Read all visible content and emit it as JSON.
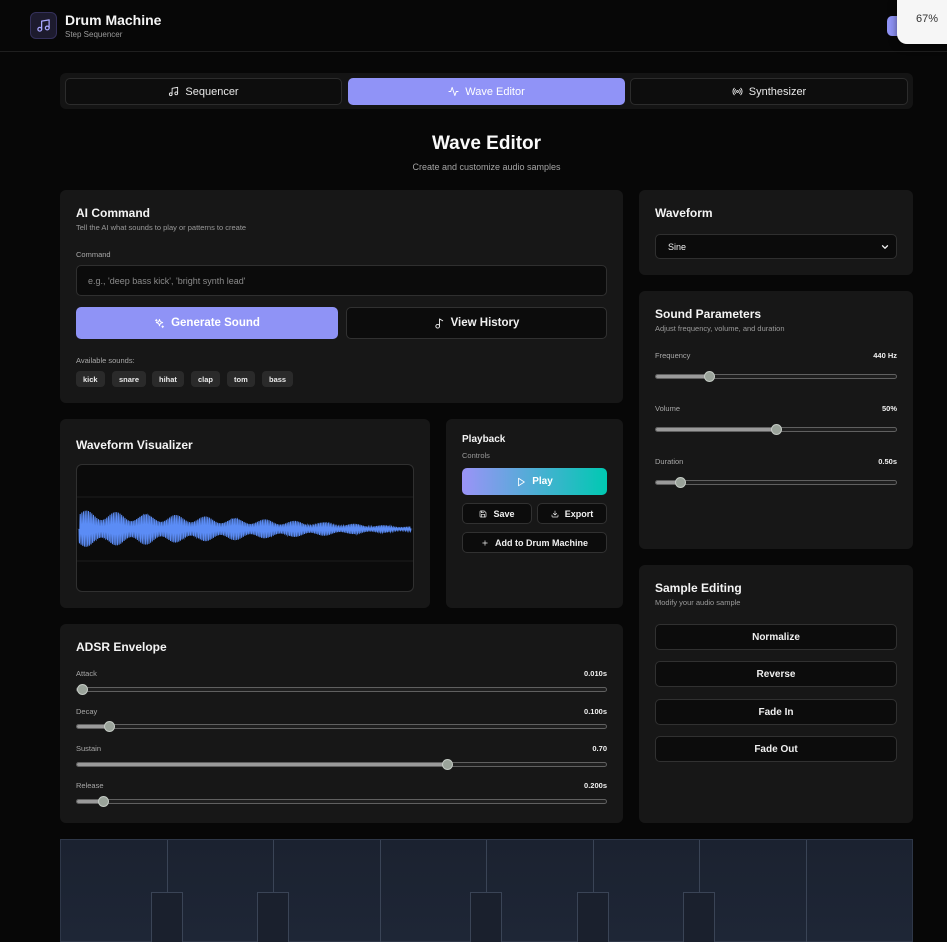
{
  "header": {
    "title": "Drum Machine",
    "subtitle": "Step Sequencer",
    "zoom": "67%"
  },
  "tabs": [
    {
      "label": "Sequencer",
      "icon": "music-note-icon",
      "active": false
    },
    {
      "label": "Wave Editor",
      "icon": "activity-icon",
      "active": true
    },
    {
      "label": "Synthesizer",
      "icon": "radio-icon",
      "active": false
    }
  ],
  "page": {
    "title": "Wave Editor",
    "subtitle": "Create and customize audio samples"
  },
  "ai_command": {
    "title": "AI Command",
    "description": "Tell the AI what sounds to play or patterns to create",
    "field_label": "Command",
    "placeholder": "e.g., 'deep bass kick', 'bright synth lead'",
    "generate_label": "Generate Sound",
    "history_label": "View History",
    "available_label": "Available sounds:",
    "sounds": [
      "kick",
      "snare",
      "hihat",
      "clap",
      "tom",
      "bass"
    ]
  },
  "waveform": {
    "title": "Waveform",
    "selected": "Sine"
  },
  "sound_params": {
    "title": "Sound Parameters",
    "description": "Adjust frequency, volume, and duration",
    "frequency": {
      "label": "Frequency",
      "value": "440 Hz",
      "fraction": 0.22
    },
    "volume": {
      "label": "Volume",
      "value": "50%",
      "fraction": 0.5
    },
    "duration": {
      "label": "Duration",
      "value": "0.50s",
      "fraction": 0.1
    }
  },
  "visualizer": {
    "title": "Waveform Visualizer",
    "color": "#5b8cf5"
  },
  "playback": {
    "title": "Playback",
    "description": "Controls",
    "play_label": "Play",
    "save_label": "Save",
    "export_label": "Export",
    "add_label": "Add to Drum Machine"
  },
  "sample_editing": {
    "title": "Sample Editing",
    "description": "Modify your audio sample",
    "actions": [
      "Normalize",
      "Reverse",
      "Fade In",
      "Fade Out"
    ]
  },
  "adsr": {
    "title": "ADSR Envelope",
    "attack": {
      "label": "Attack",
      "value": "0.010s",
      "fraction": 0.01
    },
    "decay": {
      "label": "Decay",
      "value": "0.100s",
      "fraction": 0.06
    },
    "sustain": {
      "label": "Sustain",
      "value": "0.70",
      "fraction": 0.7
    },
    "release": {
      "label": "Release",
      "value": "0.200s",
      "fraction": 0.05
    }
  },
  "colors": {
    "accent": "#8f93f6",
    "gradient_end": "#00c9b2"
  }
}
